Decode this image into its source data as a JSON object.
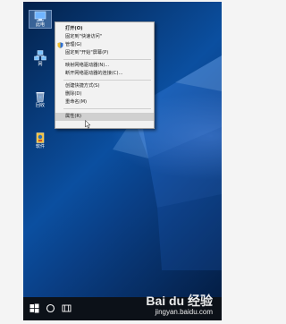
{
  "desktop": {
    "icons": [
      {
        "label": "此电",
        "icon": "computer-icon"
      },
      {
        "label": "网",
        "icon": "network-icon"
      },
      {
        "label": "回收",
        "icon": "recycle-bin-icon"
      },
      {
        "label": "软件",
        "icon": "software-icon"
      }
    ]
  },
  "context_menu": {
    "items": [
      {
        "label": "打开(O)",
        "bold": true
      },
      {
        "label": "固定到\"快速访问\""
      },
      {
        "label": "管理(G)",
        "icon": "shield-icon"
      },
      {
        "label": "固定到\"开始\"屏幕(P)"
      },
      {
        "label": "映射网络驱动器(N)..."
      },
      {
        "label": "断开网络驱动器的连接(C)..."
      },
      {
        "label": "创建快捷方式(S)"
      },
      {
        "label": "删除(D)"
      },
      {
        "label": "重命名(M)"
      },
      {
        "label": "属性(R)",
        "hover": true
      }
    ]
  },
  "taskbar": {
    "items": [
      {
        "icon": "windows-start-icon"
      },
      {
        "icon": "search-circle-icon"
      },
      {
        "icon": "task-view-icon"
      }
    ]
  },
  "watermark": {
    "logo": "Bai du 经验",
    "site": "jingyan.baidu.com"
  }
}
